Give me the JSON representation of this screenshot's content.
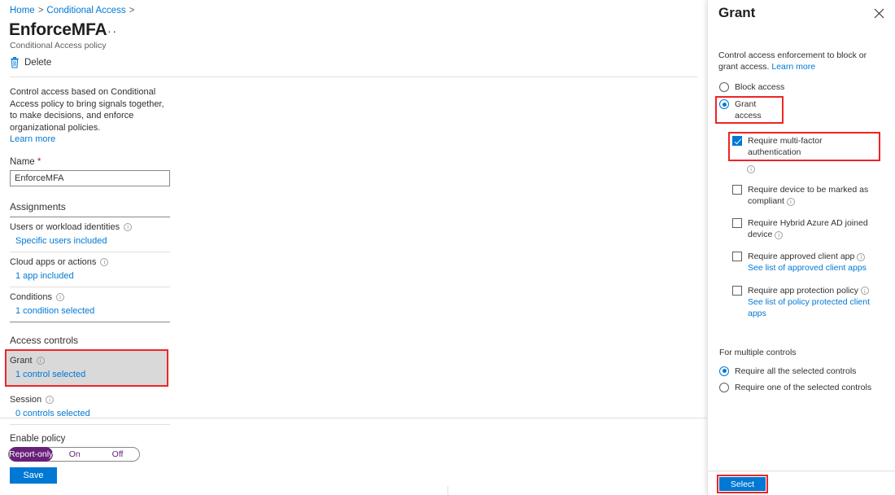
{
  "breadcrumb": {
    "items": [
      {
        "label": "Home",
        "sep": ">"
      },
      {
        "label": "Conditional Access",
        "sep": ">"
      }
    ]
  },
  "header": {
    "title": "EnforceMFA",
    "ellipsis": "···",
    "subtitle": "Conditional Access policy"
  },
  "commandbar": {
    "delete_label": "Delete",
    "delete_icon": "trash-icon"
  },
  "form": {
    "intro": "Control access based on Conditional Access policy to bring signals together, to make decisions, and enforce organizational policies.",
    "intro_link": "Learn more",
    "name_label": "Name",
    "name_required_mark": "*",
    "name_value": "EnforceMFA",
    "name_placeholder": "Name",
    "assignments_heading": "Assignments",
    "access_controls_heading": "Access controls",
    "rows": [
      {
        "label": "Users or workload identities",
        "value": "Specific users included",
        "info": "info-icon"
      },
      {
        "label": "Cloud apps or actions",
        "value": "1 app included",
        "info": "info-icon"
      },
      {
        "label": "Conditions",
        "value": "1 condition selected",
        "info": "info-icon"
      },
      {
        "label": "Grant",
        "value": "1 control selected",
        "info": "info-icon"
      },
      {
        "label": "Session",
        "value": "0 controls selected",
        "info": "info-icon"
      }
    ]
  },
  "footer": {
    "enable_label": "Enable policy",
    "toggle_options": [
      "Report-only",
      "On",
      "Off"
    ],
    "toggle_selected": "Report-only",
    "save_label": "Save"
  },
  "grant_pane": {
    "title": "Grant",
    "close_icon": "close-icon",
    "description": "Control access enforcement to block or grant access.",
    "description_link": "Learn more",
    "access_mode": {
      "selected": "Grant access",
      "options": [
        {
          "label": "Block access",
          "checked": false
        },
        {
          "label": "Grant access",
          "checked": true
        }
      ]
    },
    "controls": [
      {
        "label": "Require multi-factor authentication",
        "checked": true,
        "info": "info-icon",
        "sublink": ""
      },
      {
        "label": "Require device to be marked as compliant",
        "checked": false,
        "info": "info-icon",
        "sublink": ""
      },
      {
        "label": "Require Hybrid Azure AD joined device",
        "checked": false,
        "info": "info-icon",
        "sublink": ""
      },
      {
        "label": "Require approved client app",
        "checked": false,
        "info": "info-icon",
        "sublink": "See list of approved client apps"
      },
      {
        "label": "Require app protection policy",
        "checked": false,
        "info": "info-icon",
        "sublink": "See list of policy protected client apps"
      }
    ],
    "multiple_controls": {
      "heading": "For multiple controls",
      "options": [
        {
          "label": "Require all the selected controls",
          "checked": true
        },
        {
          "label": "Require one of the selected controls",
          "checked": false
        }
      ]
    },
    "select_label": "Select"
  },
  "colors": {
    "accent_blue": "#0078d4",
    "link_blue": "#0078d4",
    "highlight_red": "#f02424",
    "report_only_purple": "#68217a",
    "row_highlight_gray": "#d9d9d9"
  }
}
